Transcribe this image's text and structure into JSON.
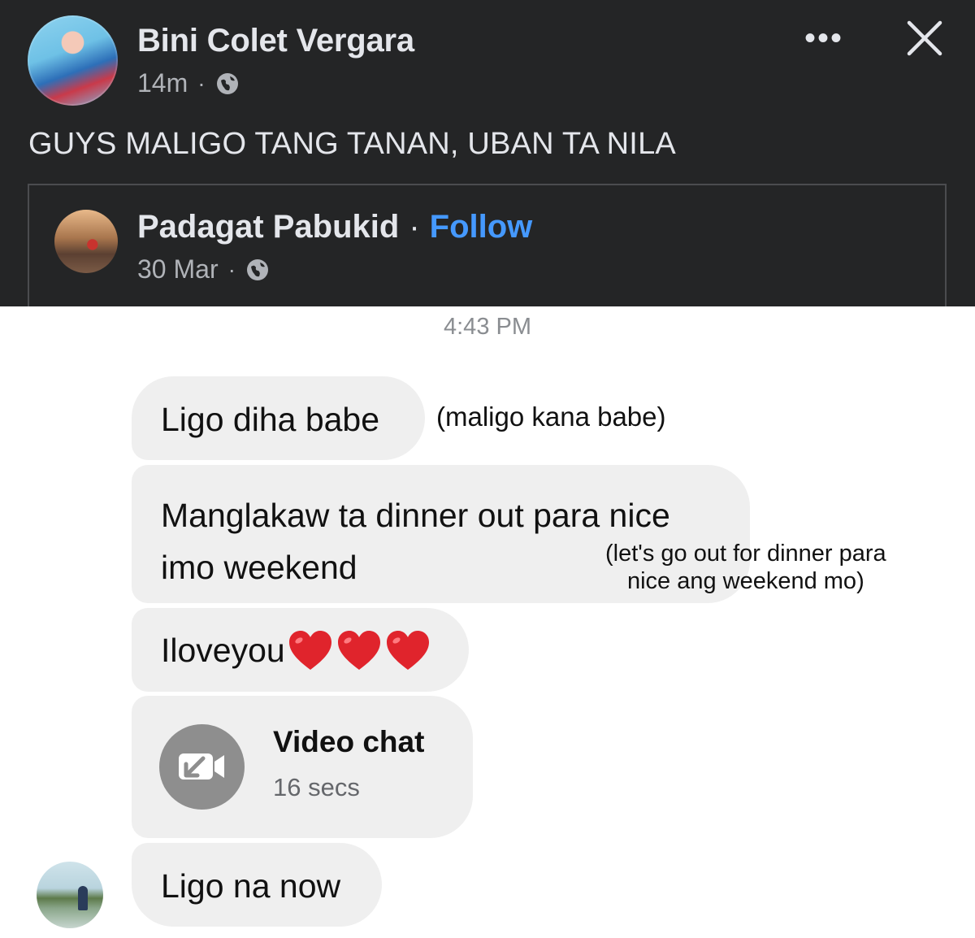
{
  "post": {
    "author": "Bini Colet Vergara",
    "time": "14m",
    "text": "GUYS MALIGO TANG TANAN, UBAN TA NILA",
    "menu_icon": "more-icon",
    "close_icon": "close-icon"
  },
  "shared": {
    "author": "Padagat Pabukid",
    "separator": "·",
    "follow_label": "Follow",
    "date": "30 Mar"
  },
  "meta_dot": "·",
  "chat": {
    "timestamp": "4:43 PM",
    "messages": [
      {
        "text": "Ligo diha babe",
        "translation": "(maligo kana babe)"
      },
      {
        "text_line1": "Manglakaw ta dinner out para nice",
        "text_line2": "imo weekend",
        "translation_line1": "(let's go out for dinner para",
        "translation_line2": "nice ang weekend mo)"
      },
      {
        "text": "Iloveyou"
      },
      {
        "video_title": "Video chat",
        "video_duration": "16 secs"
      },
      {
        "text": "Ligo na now"
      }
    ]
  },
  "colors": {
    "dark_bg": "#242526",
    "follow_blue": "#4599ff",
    "bubble_gray": "#efefef",
    "heart_red": "#e0242c"
  }
}
